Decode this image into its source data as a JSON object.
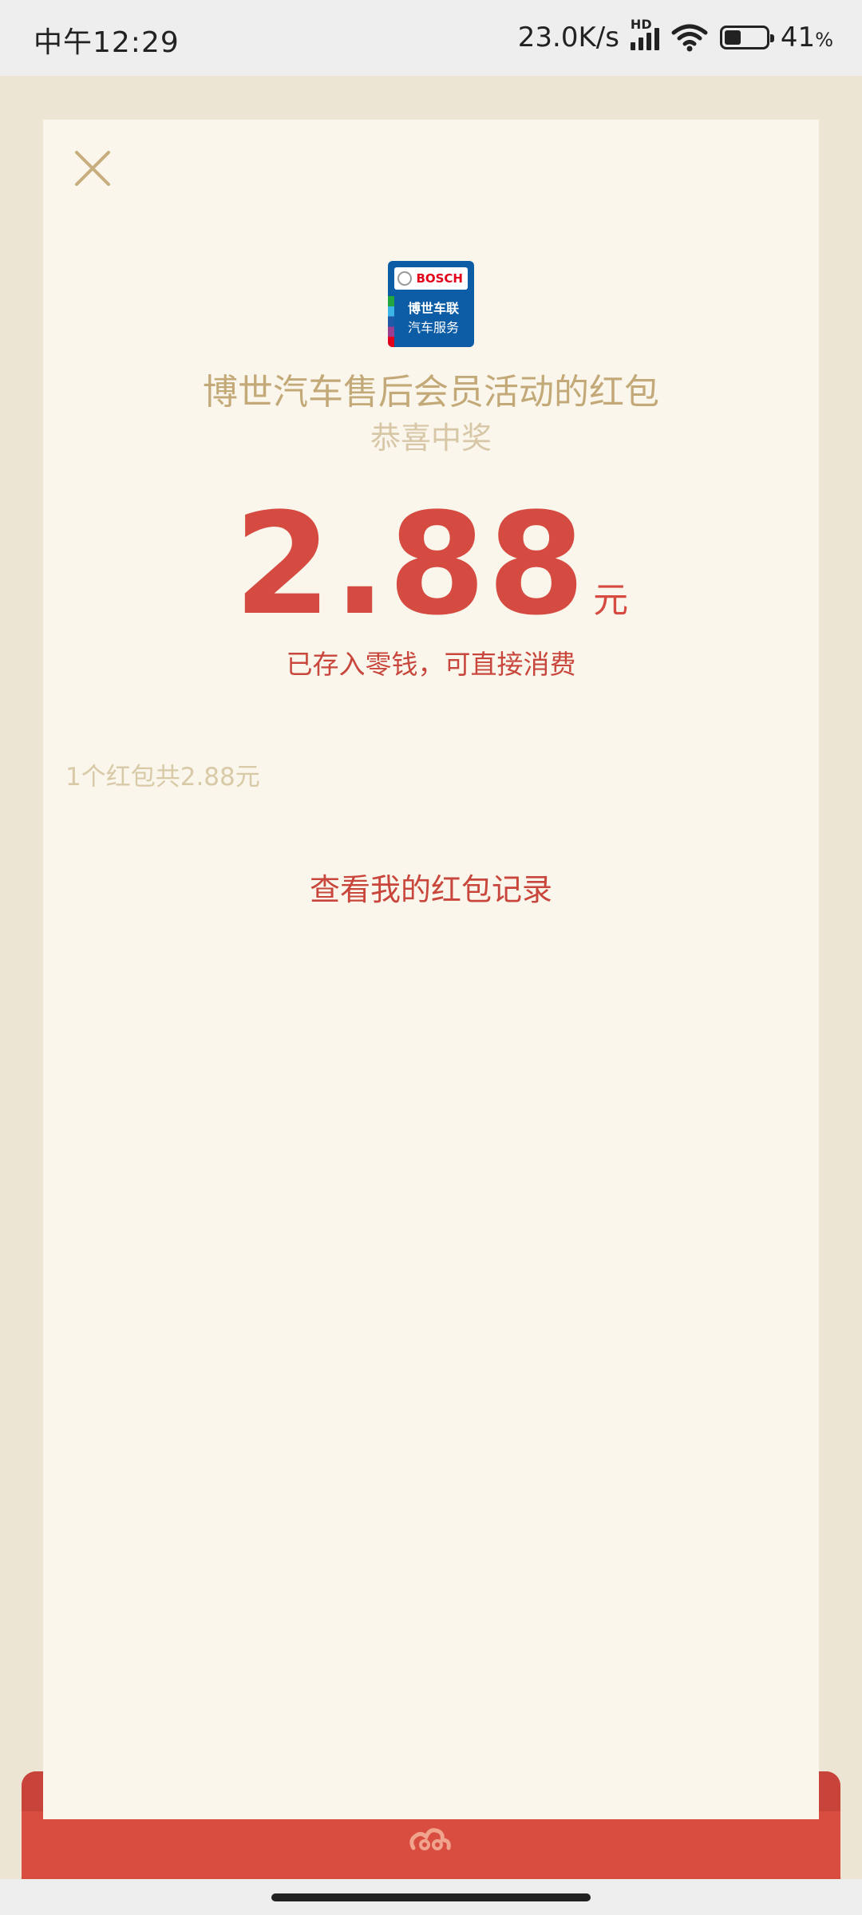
{
  "status_bar": {
    "time": "中午12:29",
    "net_speed": "23.0K/s",
    "network_badge": "HD",
    "battery_percent": "41",
    "battery_suffix": "%",
    "battery_level": 0.41
  },
  "colors": {
    "accent_red": "#d64b41",
    "gold": "#c3a978",
    "card_bg": "#faf6ec",
    "page_bg": "#ede5d4"
  },
  "logo": {
    "brand": "BOSCH",
    "line1": "博世车联",
    "line2": "汽车服务"
  },
  "envelope": {
    "title": "博世汽车售后会员活动的红包",
    "subtitle": "恭喜中奖",
    "amount": "2.88",
    "unit": "元",
    "note": "已存入零钱，可直接消费",
    "summary": "1个红包共2.88元",
    "records_link": "查看我的红包记录"
  },
  "icons": {
    "close": "close-icon",
    "cloud": "auspicious-cloud-icon"
  }
}
